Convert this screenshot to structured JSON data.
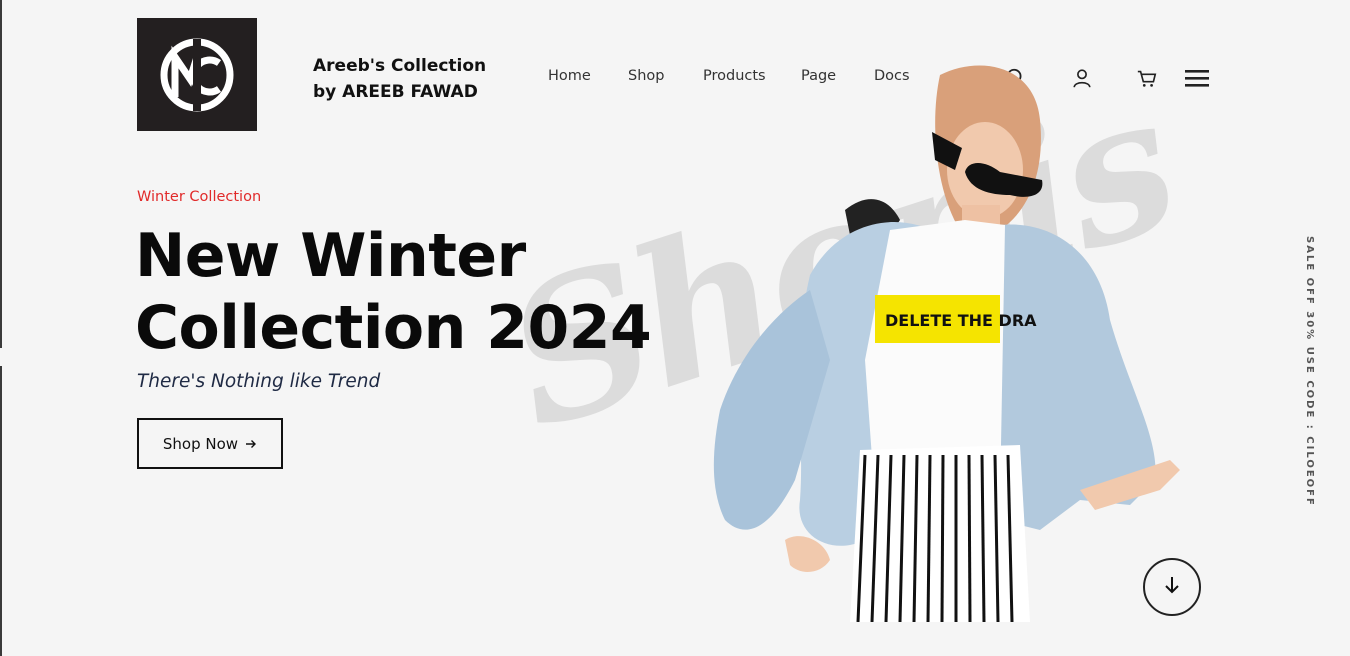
{
  "brand": {
    "logo_icon": "mc-logo-icon",
    "line1": "Areeb's Collection",
    "line2": "by AREEB FAWAD"
  },
  "nav": {
    "items": [
      {
        "label": "Home"
      },
      {
        "label": "Shop"
      },
      {
        "label": "Products"
      },
      {
        "label": "Page"
      },
      {
        "label": "Docs"
      }
    ]
  },
  "header_icons": [
    "search-icon",
    "user-icon",
    "cart-icon",
    "menu-icon"
  ],
  "hero": {
    "eyebrow": "Winter Collection",
    "title_line1": "New Winter",
    "title_line2": "Collection 2024",
    "tagline": "There's Nothing like Trend",
    "cta_label": "Shop Now",
    "cta_icon": "arrow-right-icon",
    "watermark": "Shopis",
    "image": "fashion-model-image"
  },
  "side_banner": "SALE OFF 30% USE CODE : CILOEOFF",
  "scroll_icon": "arrow-down-icon",
  "colors": {
    "background": "#f5f5f5",
    "accent": "#e12a2a",
    "logo_bg": "#231f20",
    "text": "#0a0a0a"
  }
}
